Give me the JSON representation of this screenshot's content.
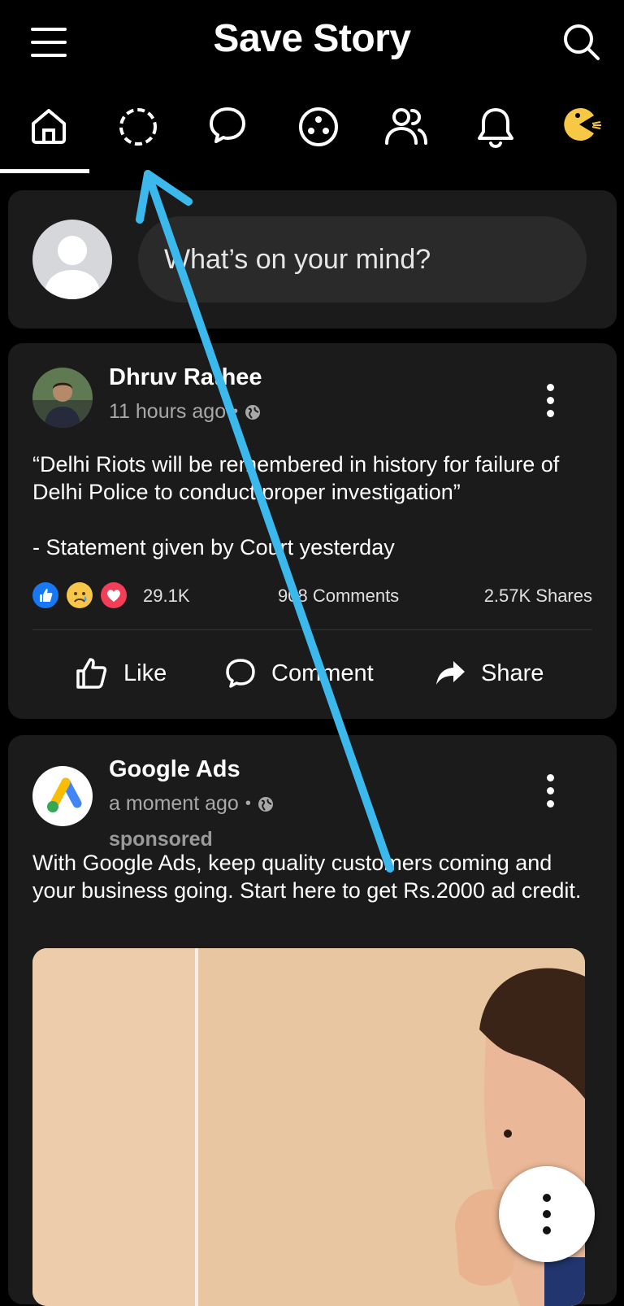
{
  "header": {
    "title": "Save Story",
    "menu_icon": "hamburger-menu-icon",
    "search_icon": "search-icon"
  },
  "tabs": [
    {
      "icon": "home-icon",
      "selected": true
    },
    {
      "icon": "stories-loading-icon",
      "selected": false
    },
    {
      "icon": "messenger-icon",
      "selected": false
    },
    {
      "icon": "groups-icon",
      "selected": false
    },
    {
      "icon": "friends-icon",
      "selected": false
    },
    {
      "icon": "notifications-icon",
      "selected": false
    },
    {
      "icon": "pacman-icon",
      "selected": false
    }
  ],
  "composer": {
    "placeholder": "What’s on your mind?"
  },
  "posts": [
    {
      "author": "Dhruv Rathee",
      "time": "11 hours ago",
      "privacy_icon": "globe-icon",
      "text_line1": "“Delhi Riots will be remembered in history for failure of Delhi Police to conduct proper investigation”",
      "text_line2": "- Statement given by Court yesterday",
      "reactions": [
        "like",
        "sad",
        "love"
      ],
      "likes": "29.1K",
      "comments": "908 Comments",
      "shares": "2.57K Shares",
      "actions": {
        "like": "Like",
        "comment": "Comment",
        "share": "Share"
      }
    },
    {
      "author": "Google Ads",
      "time": "a moment ago",
      "privacy_icon": "globe-icon",
      "sponsored": "sponsored",
      "text": "With Google Ads, keep quality customers coming and your business going. Start here to get Rs.2000 ad credit."
    }
  ],
  "colors": {
    "background": "#000000",
    "card": "#1b1b1b",
    "annotation_arrow": "#3bb8ec",
    "like_blue": "#1877f2",
    "love_red": "#f33e58",
    "sad_yellow": "#f7c64a",
    "pacman_yellow": "#f7c843"
  },
  "fab_icon": "more-vertical-icon"
}
